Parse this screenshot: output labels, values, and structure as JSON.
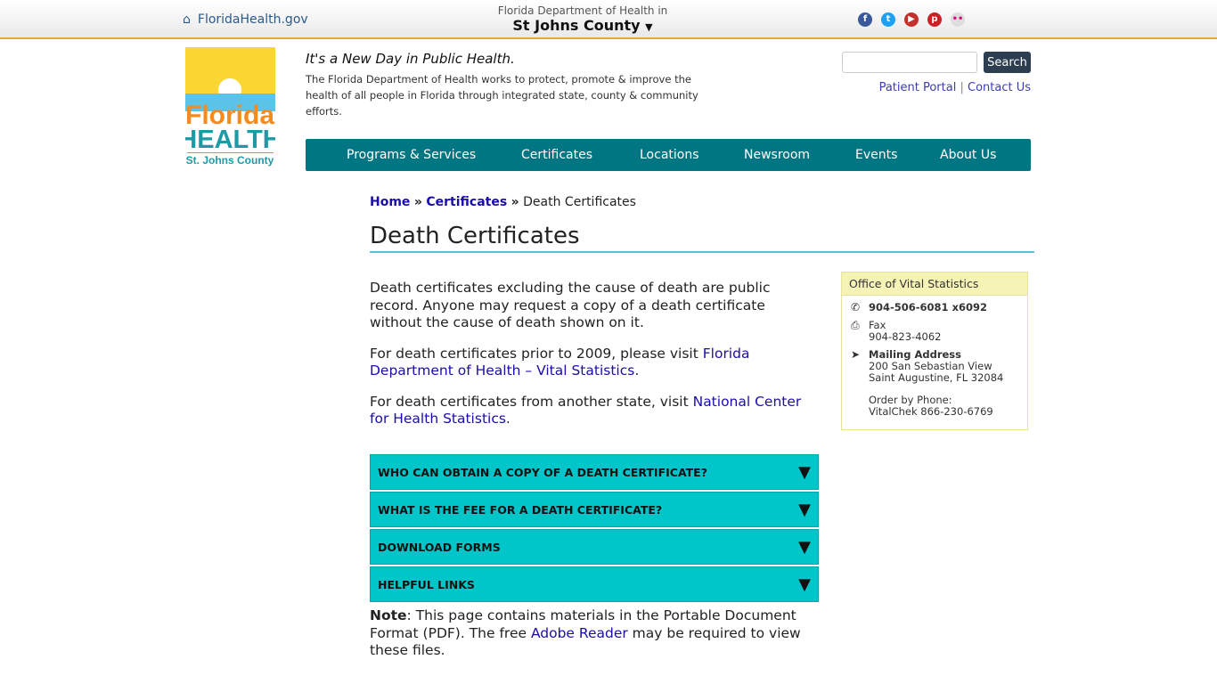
{
  "topbar": {
    "home_link": "FloridaHealth.gov",
    "dept_line": "Florida Department of Health in",
    "county": "St Johns County",
    "social": [
      "facebook-icon",
      "twitter-icon",
      "youtube-icon",
      "pinterest-icon",
      "flickr-icon"
    ]
  },
  "logo": {
    "text1": "Florida",
    "text2": "HEALTH",
    "text3": "St. Johns County"
  },
  "header": {
    "tagline": "It's a New Day in Public Health.",
    "mission": "The Florida Department of Health works to protect, promote & improve the health of all people in Florida through integrated state, county & community efforts.",
    "search_button": "Search",
    "search_placeholder": "",
    "patient_portal": "Patient Portal",
    "separator": "|",
    "contact_us": "Contact Us"
  },
  "nav": [
    "Programs & Services",
    "Certificates",
    "Locations",
    "Newsroom",
    "Events",
    "About Us"
  ],
  "breadcrumb": {
    "home": "Home",
    "certificates": "Certificates",
    "sep": "»",
    "current": "Death Certificates"
  },
  "page_title": "Death Certificates",
  "content": {
    "p1": "Death certificates excluding the cause of death are public record. Anyone may request a copy of a death certificate without the cause of death shown on it.",
    "p2_pre": "For death certificates prior to 2009, please visit ",
    "p2_link": "Florida Department of Health – Vital Statistics",
    "p2_post": ".",
    "p3_pre": "For death certificates from another state, visit ",
    "p3_link": "National Center for Health Statistics",
    "p3_post": "."
  },
  "accordion": [
    "WHO CAN OBTAIN A COPY OF A DEATH CERTIFICATE?",
    "WHAT IS THE FEE FOR A DEATH CERTIFICATE?",
    "DOWNLOAD FORMS",
    "HELPFUL LINKS"
  ],
  "note": {
    "label": "Note",
    "pre": ": This page contains materials in the Portable Document Format (PDF). The free ",
    "link": "Adobe Reader",
    "post": " may be required to view these files."
  },
  "sidebar": {
    "title": "Office of Vital Statistics",
    "phone": "904-506-6081 x6092",
    "fax_label": "Fax",
    "fax": "904-823-4062",
    "mail_label": "Mailing Address",
    "addr1": "200 San Sebastian View",
    "addr2": "Saint Augustine, FL 32084",
    "order1": "Order by Phone:",
    "order2": "VitalChek 866-230-6769"
  }
}
